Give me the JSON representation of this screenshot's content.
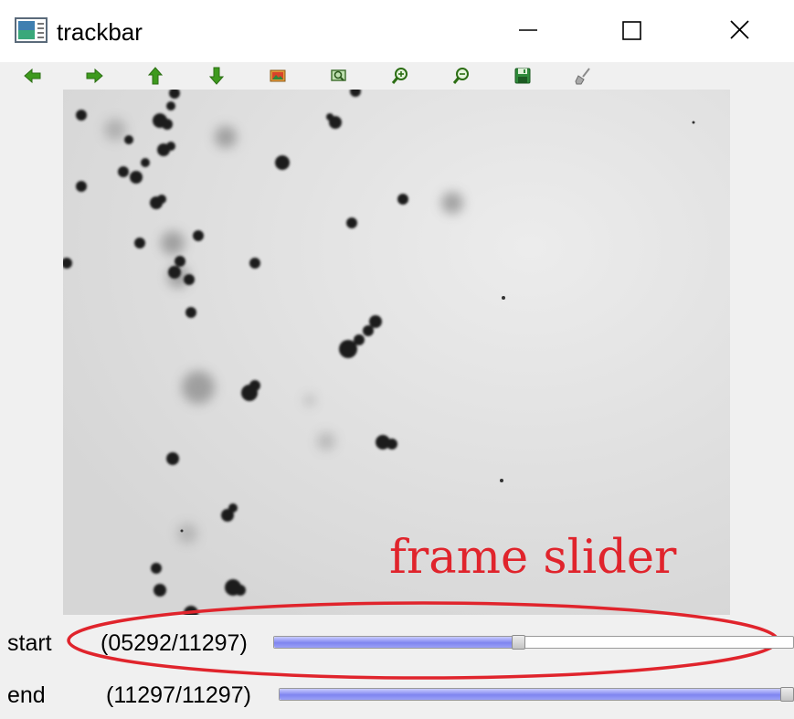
{
  "window": {
    "title": "trackbar",
    "controls": [
      "minimize-icon",
      "maximize-icon",
      "close-icon"
    ]
  },
  "toolbar": {
    "tools": [
      "arrow-left-icon",
      "arrow-right-icon",
      "arrow-up-icon",
      "arrow-down-icon",
      "image-icon",
      "zoom-fit-icon",
      "zoom-in-icon",
      "zoom-out-icon",
      "save-icon",
      "broom-icon"
    ]
  },
  "overlay": {
    "annotation": "frame slider",
    "color": "#e0242c"
  },
  "trackbars": {
    "start": {
      "label": "start",
      "value": "(05292/11297)",
      "current": 5292,
      "max": 11297
    },
    "end": {
      "label": "end",
      "value": "(11297/11297)",
      "current": 11297,
      "max": 11297
    }
  },
  "colors": {
    "slider_fill": "#7f85f0",
    "background": "#f0f0f0",
    "image_background": "#dedede"
  }
}
